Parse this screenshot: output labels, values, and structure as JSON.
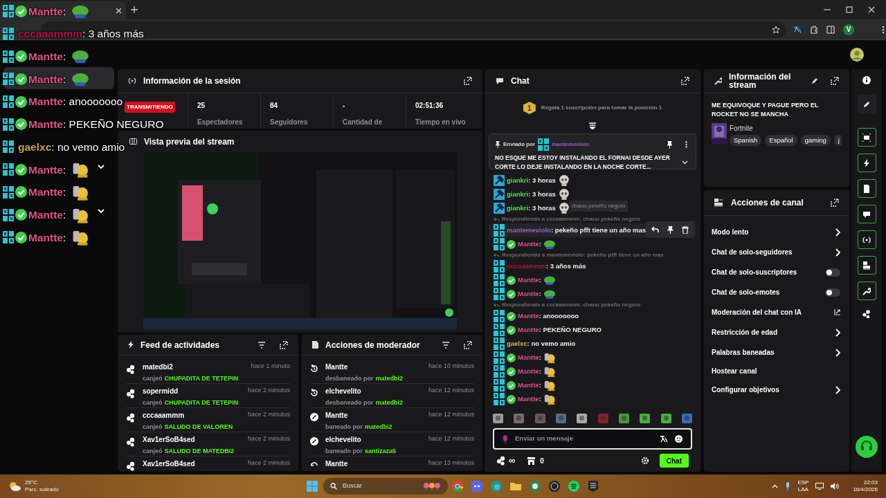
{
  "browser": {
    "profile_initial": "V"
  },
  "overlay_chat": [
    {
      "badge": {
        "kind": "og"
      },
      "verified": true,
      "user": "Mantte",
      "color": "#e0528a",
      "text": ":",
      "emote": {
        "kind": "frog"
      }
    },
    {
      "badge": {
        "kind": "og"
      },
      "verified": false,
      "user": "cccaaammm",
      "color": "#b3123c",
      "text": ": 3 años más"
    },
    {
      "badge": {
        "kind": "og"
      },
      "verified": true,
      "user": "Mantte",
      "color": "#e0528a",
      "text": ":",
      "emote": {
        "kind": "frog"
      }
    },
    {
      "badge": {
        "kind": "og"
      },
      "verified": true,
      "user": "Mantte",
      "color": "#e0528a",
      "text": ":",
      "emote": {
        "kind": "frog"
      }
    },
    {
      "badge": {
        "kind": "og"
      },
      "verified": true,
      "user": "Mantte",
      "color": "#e0528a",
      "text": ": anooooooo"
    },
    {
      "badge": {
        "kind": "og"
      },
      "verified": true,
      "user": "Mantte",
      "color": "#e0528a",
      "text": ": PEKEÑO NEGURO"
    },
    {
      "badge": {
        "kind": "og"
      },
      "verified": false,
      "user": "gaelxc",
      "color": "#c9a04c",
      "text": ": no vemo amio"
    },
    {
      "badge": {
        "kind": "og"
      },
      "verified": true,
      "user": "Mantte",
      "color": "#e0528a",
      "text": ":",
      "emote": {
        "kind": "hands"
      }
    },
    {
      "badge": {
        "kind": "og"
      },
      "verified": true,
      "user": "Mantte",
      "color": "#e0528a",
      "text": ":",
      "emote": {
        "kind": "hands"
      }
    },
    {
      "badge": {
        "kind": "og"
      },
      "verified": true,
      "user": "Mantte",
      "color": "#e0528a",
      "text": ":",
      "emote": {
        "kind": "hands"
      }
    },
    {
      "badge": {
        "kind": "og"
      },
      "verified": true,
      "user": "Mantte",
      "color": "#e0528a",
      "text": ":",
      "emote": {
        "kind": "hands"
      }
    }
  ],
  "session": {
    "title": "Información de la sesión",
    "status": "TRANSMITIENDO",
    "live": true,
    "stats": [
      {
        "value": "25",
        "label": "Espectadores"
      },
      {
        "value": "84",
        "label": "Seguidores"
      },
      {
        "value": "-",
        "label": "Cantidad de"
      },
      {
        "value": "02:51:36",
        "label": "Tiempo en vivo"
      }
    ]
  },
  "preview": {
    "title": "Vista previa del stream"
  },
  "activity_feed": {
    "title": "Feed de actividades",
    "items": [
      {
        "user": "matedbi2",
        "time": "hace 1 minuto",
        "action": "canjeó",
        "reward": "CHUPADITA DE TETEPIN"
      },
      {
        "user": "sopermidd",
        "time": "hace 2 minutos",
        "action": "canjeó",
        "reward": "CHUPADITA DE TETEPIN"
      },
      {
        "user": "cccaaammm",
        "time": "hace 2 minutos",
        "action": "canjeó",
        "reward": "SALUDO DE VALOREN"
      },
      {
        "user": "Xav1erSoB4sed",
        "time": "hace 2 minutos",
        "action": "canjeó",
        "reward": "SALUDO DE MATEDBI2"
      },
      {
        "user": "Xav1erSoB4sed",
        "time": "hace 2 minutos"
      }
    ]
  },
  "mod_actions": {
    "title": "Acciones de moderador",
    "items": [
      {
        "kind": "unban",
        "user": "Mantte",
        "time": "hace 10 minutos",
        "action": "desbaneado por",
        "moderator": "matedbi2"
      },
      {
        "kind": "unban",
        "user": "elchevelito",
        "time": "hace 12 minutos",
        "action": "desbaneado por",
        "moderator": "matedbi2"
      },
      {
        "kind": "ban",
        "user": "Mantte",
        "time": "hace 12 minutos",
        "action": "baneado por",
        "moderator": "matedbi2"
      },
      {
        "kind": "ban",
        "user": "elchevelito",
        "time": "hace 12 minutos",
        "action": "baneado por",
        "moderator": "santizaza5"
      },
      {
        "kind": "undo",
        "user": "Mantte",
        "time": "hace 13 minutos"
      }
    ]
  },
  "chat": {
    "title": "Chat",
    "gift_rank": "1",
    "gift_text": "Regala 1 suscripción para tomar la posición 1",
    "pinned": {
      "label": "Enviado por",
      "user": "mantemeviolo",
      "color": "#9b5fc0",
      "text": "NO ESQUE ME ESTOY INSTALANDO EL FORNAI DESDE AYER CORTE LO DEJE INSTALANDO EN LA NOCHE CORTE..."
    },
    "tooltip": "chauu pekeño neguro",
    "messages": [
      {
        "kind": "message",
        "badge": {
          "kind": "mod"
        },
        "verified": false,
        "user": "giankri",
        "color": "#53e04f",
        "text": ": 3 horas",
        "emote": {
          "kind": "skull"
        },
        "hovered": false
      },
      {
        "kind": "message",
        "badge": {
          "kind": "mod"
        },
        "verified": false,
        "user": "giankri",
        "color": "#53e04f",
        "text": ": 3 horas",
        "emote": {
          "kind": "skull"
        },
        "hovered": false
      },
      {
        "kind": "message",
        "badge": {
          "kind": "mod"
        },
        "verified": false,
        "user": "giankri",
        "color": "#53e04f",
        "text": ": 3 horas",
        "emote": {
          "kind": "skull"
        },
        "hovered": false
      },
      {
        "kind": "reply",
        "text": "Respondiendo a cccaaammm: chauu pekeño neguro"
      },
      {
        "kind": "message",
        "badge": {
          "kind": "og"
        },
        "verified": false,
        "user": "mantemeviolo",
        "color": "#9b5fc0",
        "text": ": pekeño pfft tiene un año mas",
        "hovered": true
      },
      {
        "kind": "message",
        "badge": {
          "kind": "og"
        },
        "verified": true,
        "user": "Mantte",
        "color": "#d9508a",
        "text": ":",
        "emote": {
          "kind": "frog"
        },
        "hovered": false
      },
      {
        "kind": "reply",
        "text": "Respondiendo a mantemeviolo: pekeño pfft tiene un año mas"
      },
      {
        "kind": "message",
        "badge": {
          "kind": "og"
        },
        "verified": false,
        "user": "cccaaammm",
        "color": "#b3123c",
        "text": ": 3 años más",
        "hovered": false
      },
      {
        "kind": "message",
        "badge": {
          "kind": "og"
        },
        "verified": true,
        "user": "Mantte",
        "color": "#d9508a",
        "text": ":",
        "emote": {
          "kind": "frog"
        },
        "hovered": false
      },
      {
        "kind": "message",
        "badge": {
          "kind": "og"
        },
        "verified": true,
        "user": "Mantte",
        "color": "#d9508a",
        "text": ":",
        "emote": {
          "kind": "frog"
        },
        "hovered": false
      },
      {
        "kind": "reply",
        "text": "Respondiendo a cccaaammm: chauu pekeño neguro"
      },
      {
        "kind": "message",
        "badge": {
          "kind": "og"
        },
        "verified": true,
        "user": "Mantte",
        "color": "#d9508a",
        "text": ": anooooooo",
        "hovered": false
      },
      {
        "kind": "message",
        "badge": {
          "kind": "og"
        },
        "verified": true,
        "user": "Mantte",
        "color": "#d9508a",
        "text": ": PEKEÑO NEGURO",
        "hovered": false
      },
      {
        "kind": "message",
        "badge": {
          "kind": "og"
        },
        "verified": false,
        "user": "gaelxc",
        "color": "#d9b15a",
        "text": ": no vemo amio",
        "hovered": false
      },
      {
        "kind": "message",
        "badge": {
          "kind": "og"
        },
        "verified": true,
        "user": "Mantte",
        "color": "#d9508a",
        "text": ":",
        "emote": {
          "kind": "hands"
        },
        "hovered": false
      },
      {
        "kind": "message",
        "badge": {
          "kind": "og"
        },
        "verified": true,
        "user": "Mantte",
        "color": "#d9508a",
        "text": ":",
        "emote": {
          "kind": "hands"
        },
        "hovered": false
      },
      {
        "kind": "message",
        "badge": {
          "kind": "og"
        },
        "verified": true,
        "user": "Mantte",
        "color": "#d9508a",
        "text": ":",
        "emote": {
          "kind": "hands"
        },
        "hovered": false
      },
      {
        "kind": "message",
        "badge": {
          "kind": "og"
        },
        "verified": true,
        "user": "Mantte",
        "color": "#d9508a",
        "text": ":",
        "emote": {
          "kind": "hands"
        },
        "hovered": false
      }
    ],
    "input_placeholder": "Enviar un mensaje",
    "points": "∞",
    "shop_count": "0",
    "send_label": "Chat"
  },
  "stream_info": {
    "title": "Información del stream",
    "stream_title": "ME EQUIVOQUE Y PAGUE PERO EL ROCKET NO SE MANCHA",
    "category": "Fortnite",
    "tags": [
      "Spanish",
      "Español",
      "gaming",
      "j"
    ]
  },
  "channel_actions": {
    "title": "Acciones de canal",
    "items": [
      {
        "kind": "submenu",
        "label": "Modo lento"
      },
      {
        "kind": "submenu",
        "label": "Chat de solo-seguidores"
      },
      {
        "kind": "toggle",
        "label": "Chat de solo-suscriptores",
        "on": false
      },
      {
        "kind": "toggle",
        "label": "Chat de solo-emotes",
        "on": false
      },
      {
        "kind": "external",
        "label": "Moderación del chat con IA"
      },
      {
        "kind": "submenu",
        "label": "Restricción de edad"
      },
      {
        "kind": "submenu",
        "label": "Palabras baneadas"
      },
      {
        "kind": "plain",
        "label": "Hostear canal"
      },
      {
        "kind": "submenu",
        "label": "Configurar objetivos"
      }
    ]
  },
  "taskbar": {
    "temperature": "25°C",
    "weather": "Parc. soleado",
    "search_placeholder": "Buscar",
    "language": "ESP",
    "layout": "LAA",
    "time": "22:03",
    "date": "16/4/2026"
  }
}
